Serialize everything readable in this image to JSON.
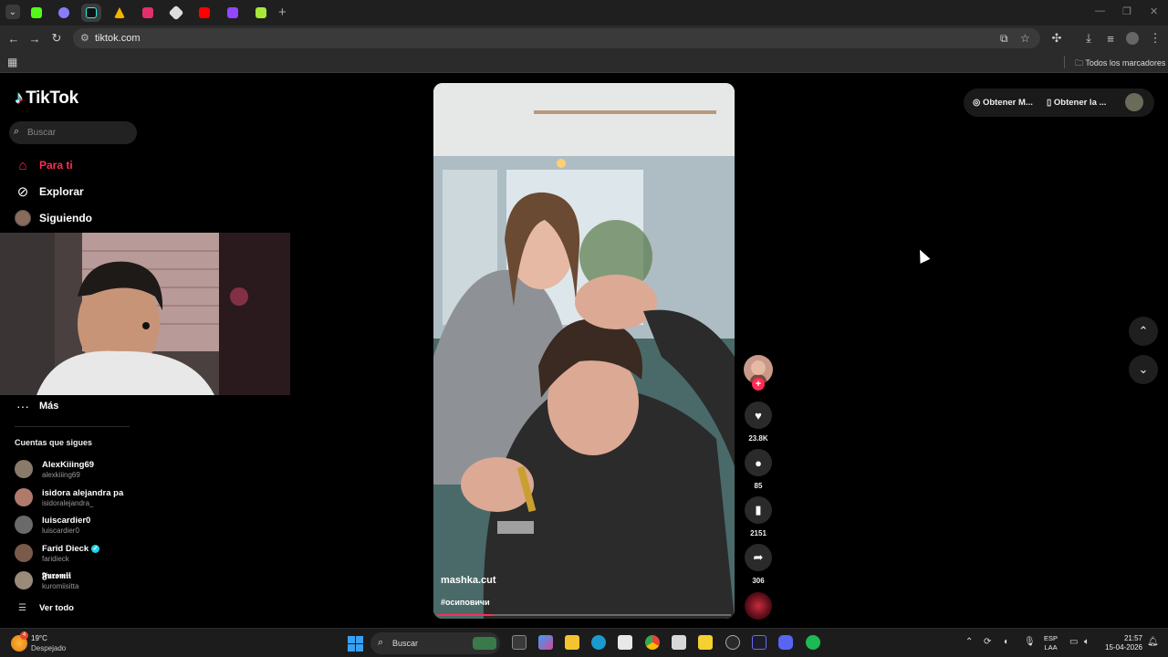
{
  "browser": {
    "url": "tiktok.com",
    "bookmarks_all_label": "Todos los marcadores",
    "tabs": [
      {
        "name": "kick",
        "color": "#53fc18",
        "active": false
      },
      {
        "name": "opera-gx",
        "color": "#8a7cff",
        "active": false
      },
      {
        "name": "tiktok",
        "color": "#000000",
        "active": true
      },
      {
        "name": "google-drive",
        "color": "#f4b400",
        "active": false
      },
      {
        "name": "instagram",
        "color": "#e1306c",
        "active": false
      },
      {
        "name": "extension",
        "color": "#dddddd",
        "active": false
      },
      {
        "name": "youtube",
        "color": "#ff0000",
        "active": false
      },
      {
        "name": "twitch",
        "color": "#9146ff",
        "active": false
      },
      {
        "name": "game",
        "color": "#a8e63a",
        "active": false
      }
    ]
  },
  "tiktok": {
    "logo_text": "TikTok",
    "search_placeholder": "Buscar",
    "nav": [
      {
        "label": "Para ti",
        "icon": "home-icon",
        "active": true
      },
      {
        "label": "Explorar",
        "icon": "compass-icon",
        "active": false
      },
      {
        "label": "Siguiendo",
        "icon": "avatar-icon",
        "active": false
      }
    ],
    "more_label": "Más",
    "following_title": "Cuentas que sigues",
    "following": [
      {
        "name": "AlexKiiing69",
        "handle": "alexkiiing69",
        "verified": false,
        "color": "#8a7a6a"
      },
      {
        "name": "isidora alejandra pa",
        "handle": "isidoralejandra_",
        "verified": false,
        "color": "#b07a6a"
      },
      {
        "name": "luiscardier0",
        "handle": "luiscardier0",
        "verified": false,
        "color": "#6a6a6a"
      },
      {
        "name": "Farid Dieck",
        "handle": "faridieck",
        "verified": true,
        "color": "#7a5a4a"
      },
      {
        "name": "𝕱𝖚𝖗𝖔𝖒𝖎𝖎",
        "handle": "kuromiisitta",
        "verified": false,
        "color": "#9a8a7a"
      }
    ],
    "see_all_label": "Ver todo",
    "top_right": {
      "coins_label": "Obtener M...",
      "app_label": "Obtener la ..."
    },
    "video": {
      "author": "mashka.cut",
      "hashtag": "#осиповичи",
      "progress": 0.19
    },
    "actions": {
      "likes": "23.8K",
      "comments": "85",
      "saves": "2151",
      "shares": "306"
    }
  },
  "taskbar": {
    "temperature": "19°C",
    "weather": "Despejado",
    "weather_badge": "4",
    "search_placeholder": "Buscar",
    "lang_line1": "ESP",
    "lang_line2": "LAA",
    "time": "21:57",
    "date": "15-04-2026"
  }
}
